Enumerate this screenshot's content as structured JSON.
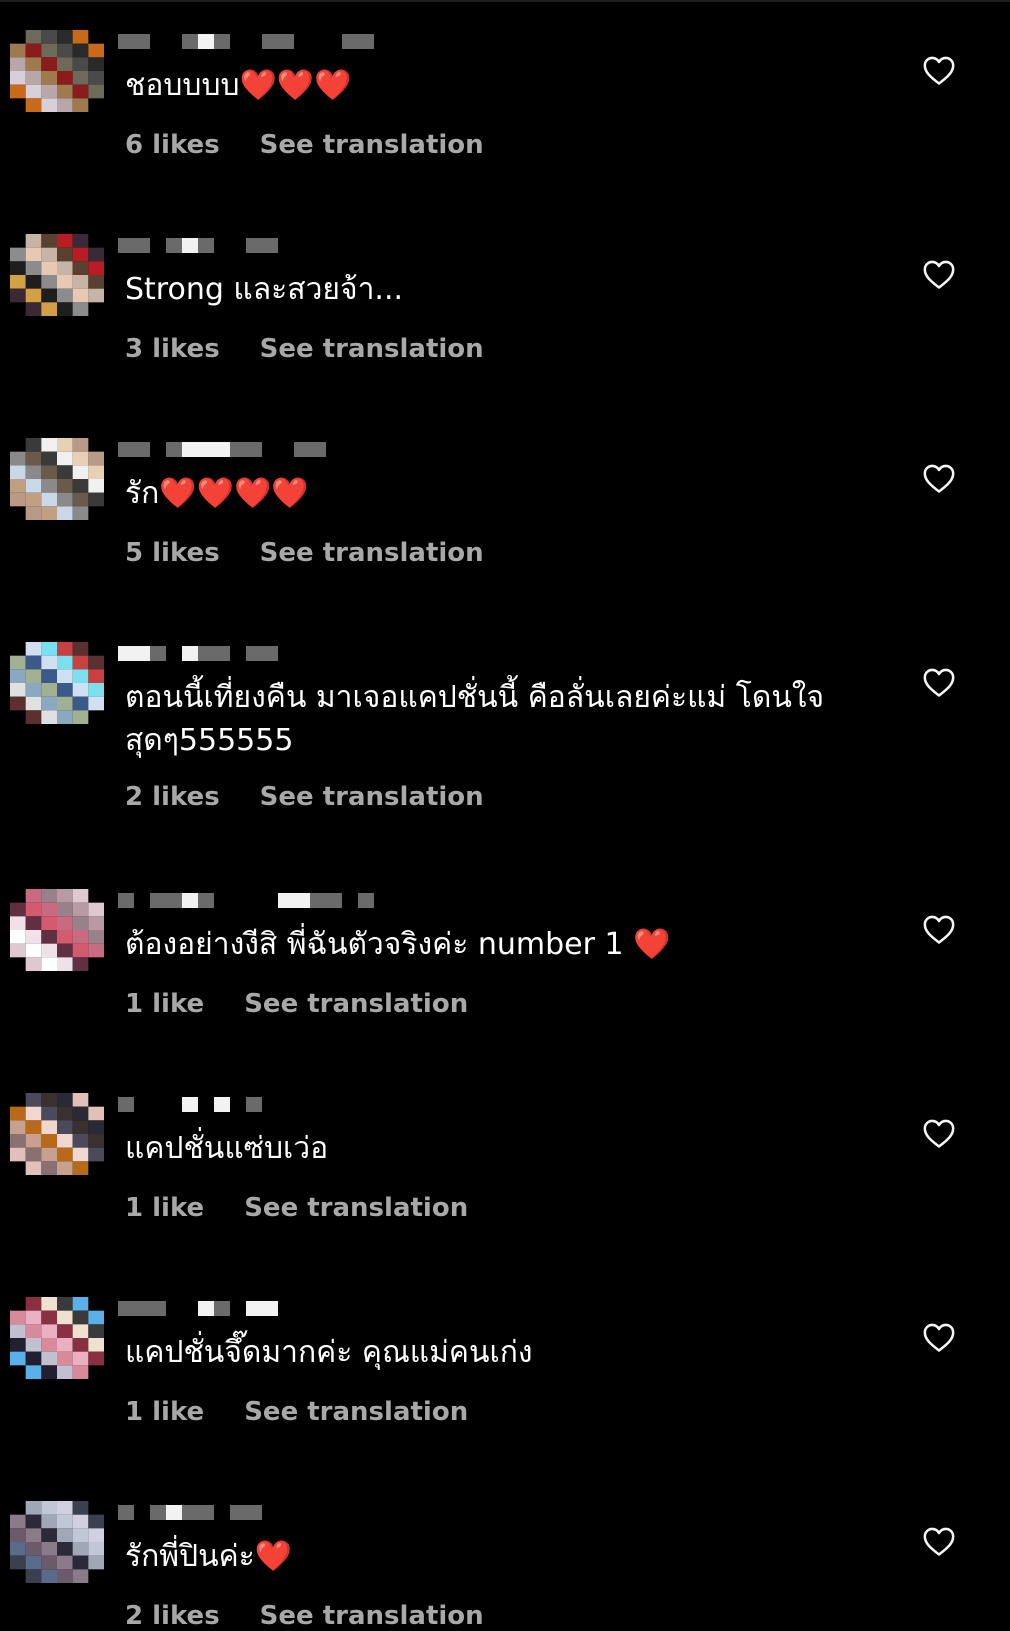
{
  "colors": {
    "background": "#000000",
    "text": "#ffffff",
    "secondary_text": "#a8a8a8",
    "heart_outline": "#f5f5f5"
  },
  "comments": [
    {
      "text": "ชอบบบบ❤️❤️❤️",
      "likes": "6 likes",
      "translate": "See translation",
      "like_icon": "heart-outline-icon"
    },
    {
      "text": "Strong และสวยจ้า...",
      "likes": "3 likes",
      "translate": "See translation",
      "like_icon": "heart-outline-icon"
    },
    {
      "text": "รัก❤️❤️❤️❤️",
      "likes": "5 likes",
      "translate": "See translation",
      "like_icon": "heart-outline-icon"
    },
    {
      "text": "ตอนนี้เที่ยงคืน มาเจอแคปชั่นนี้ คือลั่นเลยค่ะแม่ โดนใจสุดๆ555555",
      "likes": "2 likes",
      "translate": "See translation",
      "like_icon": "heart-outline-icon"
    },
    {
      "text": "ต้องอย่างงีสิ พี่ฉันตัวจริงค่ะ number 1 ❤️",
      "likes": "1 like",
      "translate": "See translation",
      "like_icon": "heart-outline-icon"
    },
    {
      "text": "แคปชั่นแซ่บเว่อ",
      "likes": "1 like",
      "translate": "See translation",
      "like_icon": "heart-outline-icon"
    },
    {
      "text": "แคปชั่นจึ๊ดมากค่ะ คุณแม่คนเก่ง",
      "likes": "1 like",
      "translate": "See translation",
      "like_icon": "heart-outline-icon"
    },
    {
      "text": "รักพี่ปินค่ะ❤️",
      "likes": "2 likes",
      "translate": "See translation",
      "like_icon": "heart-outline-icon"
    }
  ]
}
